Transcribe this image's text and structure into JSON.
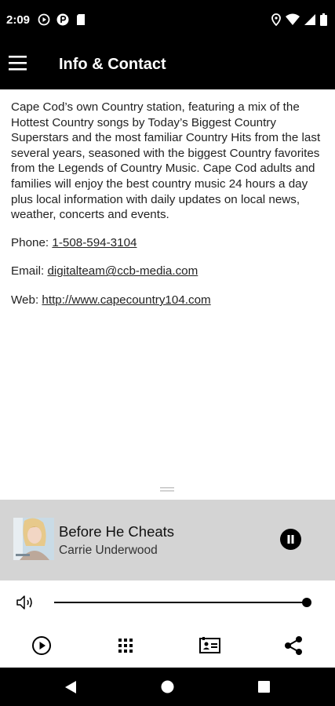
{
  "status_bar": {
    "time": "2:09",
    "left_icons": [
      "play-circle-icon",
      "parking-icon",
      "sd-card-icon"
    ],
    "right_icons": [
      "location-icon",
      "wifi-icon",
      "cell-signal-icon",
      "battery-icon"
    ]
  },
  "app_bar": {
    "menu_icon": "hamburger-menu-icon",
    "title": "Info & Contact"
  },
  "content": {
    "description": "Cape Cod’s own Country station, featuring a mix of the Hottest Country songs by Today’s Biggest Country Superstars and the most familiar Country Hits from the last several years, seasoned with the biggest Country favorites from the Legends of Country Music. Cape Cod adults and families will enjoy the best country music 24 hours a day plus local information with daily updates on local news, weather, concerts and events.",
    "phone_label": "Phone:",
    "phone_value": "1-508-594-3104",
    "email_label": "Email:",
    "email_value": "digitalteam@ccb-media.com",
    "web_label": "Web:",
    "web_value": "http://www.capecountry104.com"
  },
  "player": {
    "track_title": "Before He Cheats",
    "artist": "Carrie Underwood",
    "state": "playing",
    "volume_level": 1.0
  },
  "bottom_bar": {
    "icons": [
      "play-circle-icon",
      "grid-icon",
      "contact-card-icon",
      "share-icon"
    ]
  },
  "nav_bar": {
    "icons": [
      "back-icon",
      "home-icon",
      "recents-icon"
    ]
  },
  "colors": {
    "bar_bg": "#000000",
    "player_bg": "#d4d4d4",
    "text": "#222222"
  }
}
